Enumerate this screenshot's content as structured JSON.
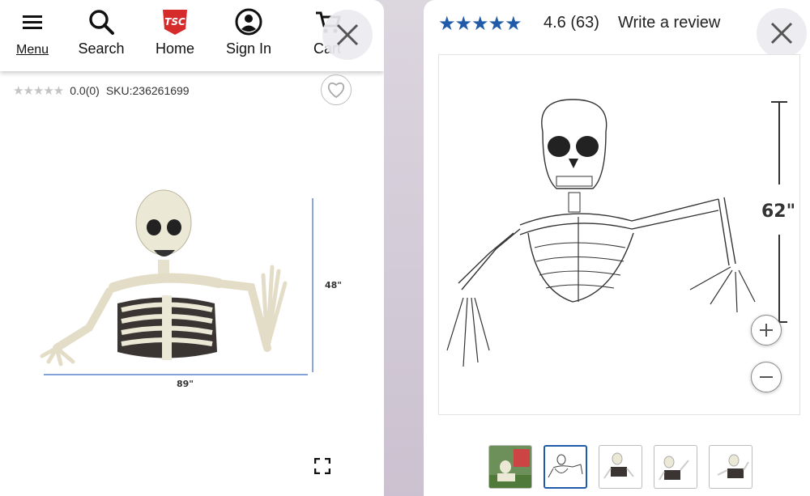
{
  "left": {
    "nav": {
      "menu": "Menu",
      "search": "Search",
      "home": "Home",
      "signin": "Sign In",
      "cart": "Cart",
      "logo_text": "TSC"
    },
    "rating": {
      "score": "0.0",
      "count": "(0)",
      "sku": "SKU:236261699"
    },
    "image": {
      "height_label": "48\"",
      "width_label": "89\""
    }
  },
  "right": {
    "review": {
      "score": "4.6",
      "count": "(63)",
      "write_label": "Write a review",
      "stars_value": 4.6
    },
    "image": {
      "height_label": "62\""
    },
    "zoom_in": "+",
    "zoom_out": "−",
    "thumbnail_count": 5,
    "active_thumbnail": 2
  },
  "icons": [
    "menu-icon",
    "search-icon",
    "tsc-logo",
    "account-icon",
    "cart-icon",
    "close-icon",
    "heart-icon",
    "expand-icon",
    "zoom-in-icon",
    "zoom-out-icon"
  ],
  "colors": {
    "review_star": "#1f5ba8",
    "logo_red": "#d52b2b",
    "empty_star": "#c4c4c4"
  }
}
